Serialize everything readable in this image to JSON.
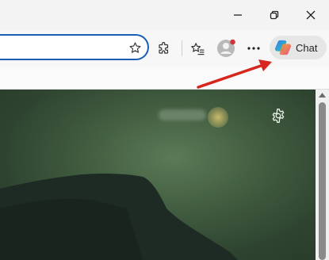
{
  "window_controls": {
    "minimize": "minimize-icon",
    "restore": "restore-icon",
    "close": "close-icon"
  },
  "toolbar": {
    "icons": [
      "star-icon",
      "extensions-icon",
      "favorites-icon",
      "profile-icon",
      "more-icon"
    ],
    "chat_label": "Chat",
    "profile_badge_color": "#d13438"
  },
  "colors": {
    "address_focus_border": "#1a5fb4",
    "annotation_arrow": "#d7261e",
    "page_background": "#3f5a3e"
  },
  "page": {
    "settings_icon": "gear-icon"
  }
}
